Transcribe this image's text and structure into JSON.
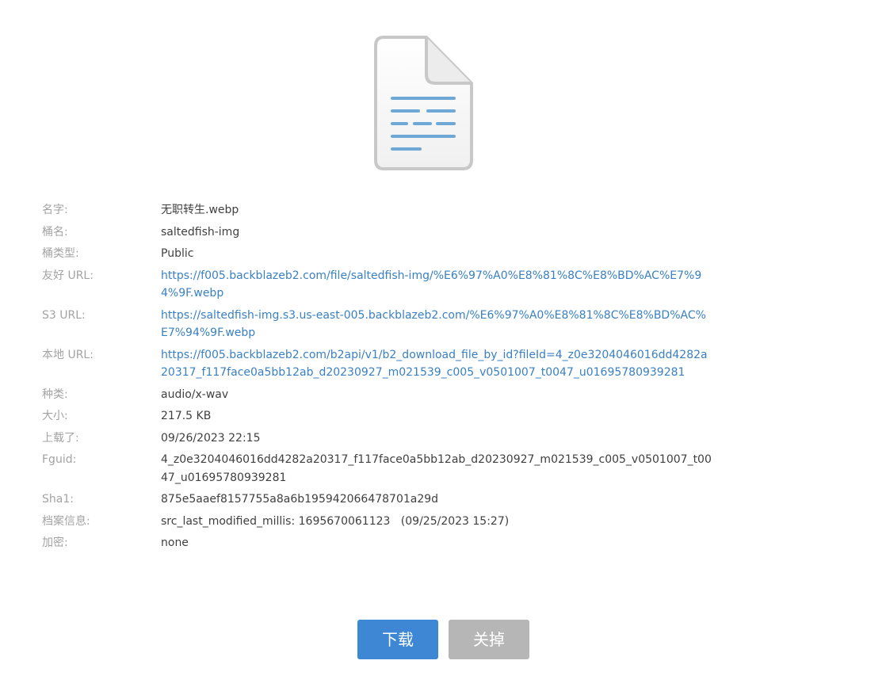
{
  "icon": "document-icon",
  "colors": {
    "link": "#3a80c4",
    "label": "#a3a3a3",
    "value": "#404040",
    "primary_button": "#3d87d5",
    "secondary_button": "#b6b6b6",
    "document_lines": "#6fa8d4"
  },
  "details": [
    {
      "label": "名字:",
      "value": "无职转生.webp",
      "link": false
    },
    {
      "label": "桶名:",
      "value": "saltedfish-img",
      "link": false
    },
    {
      "label": "桶类型:",
      "value": "Public",
      "link": false
    },
    {
      "label": "友好 URL:",
      "value": "https://f005.backblazeb2.com/file/saltedfish-img/%E6%97%A0%E8%81%8C%E8%BD%AC%E7%94%9F.webp",
      "link": true
    },
    {
      "label": "S3 URL:",
      "value": "https://saltedfish-img.s3.us-east-005.backblazeb2.com/%E6%97%A0%E8%81%8C%E8%BD%AC%E7%94%9F.webp",
      "link": true
    },
    {
      "label": "本地 URL:",
      "value": "https://f005.backblazeb2.com/b2api/v1/b2_download_file_by_id?fileId=4_z0e3204046016dd4282a20317_f117face0a5bb12ab_d20230927_m021539_c005_v0501007_t0047_u01695780939281",
      "link": true
    },
    {
      "label": "种类:",
      "value": "audio/x-wav",
      "link": false
    },
    {
      "label": "大小:",
      "value": "217.5 KB",
      "link": false
    },
    {
      "label": "上载了:",
      "value": "09/26/2023 22:15",
      "link": false
    },
    {
      "label": "Fguid:",
      "value": "4_z0e3204046016dd4282a20317_f117face0a5bb12ab_d20230927_m021539_c005_v0501007_t0047_u01695780939281",
      "link": false
    },
    {
      "label": "Sha1:",
      "value": "875e5aaef8157755a8a6b195942066478701a29d",
      "link": false
    },
    {
      "label": "档案信息:",
      "value": "src_last_modified_millis: 1695670061123   (09/25/2023 15:27)",
      "link": false
    },
    {
      "label": "加密:",
      "value": "none",
      "link": false
    }
  ],
  "buttons": {
    "download": "下载",
    "close": "关掉"
  }
}
